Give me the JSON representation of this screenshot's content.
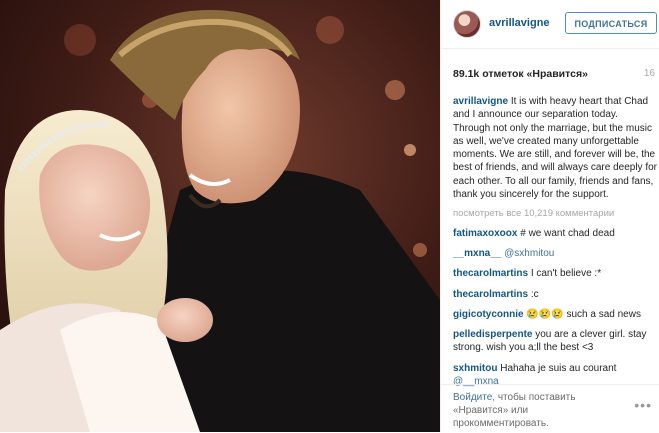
{
  "header": {
    "username": "avrillavigne",
    "follow_label": "ПОДПИСАТЬСЯ"
  },
  "likes": "89.1k отметок «Нравится»",
  "date": "16",
  "caption": {
    "user": "avrillavigne",
    "text": "It is with heavy heart that Chad and I announce our separation today. Through not only the marriage, but the music as well, we've created many unforgettable moments. We are still, and forever will be, the best of friends, and will always care deeply for each other. To all our family, friends and fans, thank you sincerely for the support."
  },
  "view_all": "посмотреть все 10,219 комментарии",
  "comments": [
    {
      "user": "fatimaxoxoox",
      "text": "# we want chad dead"
    },
    {
      "user": "__mxna__",
      "text": "@sxhmitou",
      "mention": true
    },
    {
      "user": "thecarolmartins",
      "text": "I can't believe :*"
    },
    {
      "user": "thecarolmartins",
      "text": ":c"
    },
    {
      "user": "gigicotyconnie",
      "text": "😢😢😢 such a sad news"
    },
    {
      "user": "pelledisperpente",
      "text": "you are a clever girl. stay strong. wish you a;ll the best <3"
    },
    {
      "user": "sxhmitou",
      "text": "Hahaha je suis au courant",
      "extra": "@__mxna"
    }
  ],
  "footer": {
    "login_link": "Войдите",
    "text_after": ", чтобы поставить «Нравится» или прокомментировать.",
    "more": "•••"
  },
  "colors": {
    "username": "#125688",
    "link": "#3f729b",
    "muted": "#a5a7aa"
  }
}
